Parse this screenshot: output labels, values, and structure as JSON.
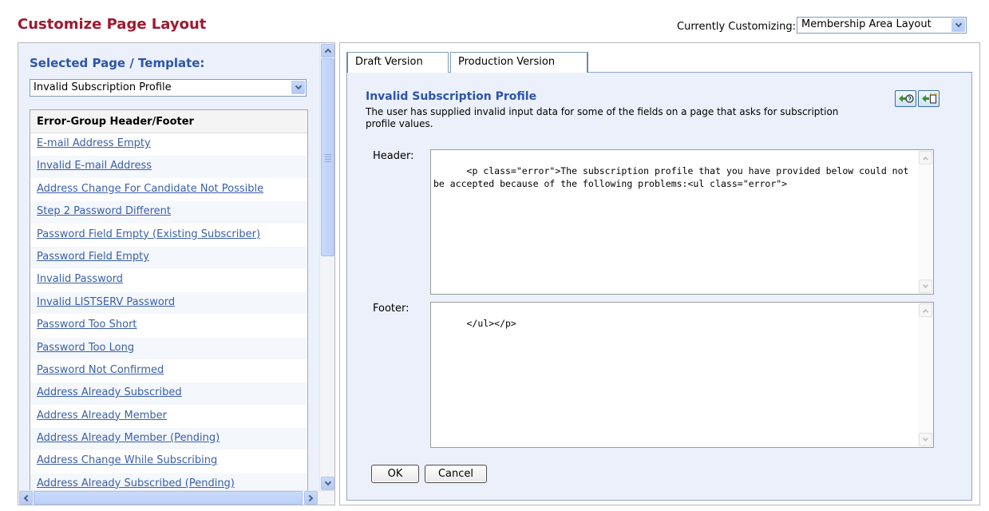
{
  "header": {
    "title": "Customize Page Layout",
    "customizing_label": "Currently Customizing:",
    "customizing_value": "Membership Area Layout"
  },
  "left": {
    "heading": "Selected Page / Template:",
    "selected_page": "Invalid Subscription Profile",
    "list_header": "Error-Group Header/Footer",
    "items": [
      "E-mail Address Empty",
      "Invalid E-mail Address",
      "Address Change For Candidate Not Possible",
      "Step 2 Password Different",
      "Password Field Empty (Existing Subscriber)",
      "Password Field Empty",
      "Invalid Password",
      "Invalid LISTSERV Password",
      "Password Too Short",
      "Password Too Long",
      "Password Not Confirmed",
      "Address Already Subscribed",
      "Address Already Member",
      "Address Already Member (Pending)",
      "Address Change While Subscribing",
      "Address Already Subscribed (Pending)"
    ]
  },
  "tabs": [
    "Draft Version",
    "Production Version"
  ],
  "editor": {
    "title": "Invalid Subscription Profile",
    "description": "The user has supplied invalid input data for some of the fields on a page that asks for subscription profile values.",
    "header_label": "Header:",
    "header_value": "<p class=\"error\">The subscription profile that you have provided below could not be accepted because of the following problems:<ul class=\"error\">",
    "footer_label": "Footer:",
    "footer_value": "</ul></p>",
    "ok_label": "OK",
    "cancel_label": "Cancel"
  },
  "colors": {
    "title": "#a0182e",
    "heading": "#2c55a8",
    "link": "#3a5fa8",
    "panel_bg": "#ebf0fa"
  },
  "icons": [
    "chevron-down-icon",
    "chevron-up-icon",
    "chevron-left-icon",
    "chevron-right-icon",
    "insert-variable-icon",
    "insert-template-icon"
  ]
}
